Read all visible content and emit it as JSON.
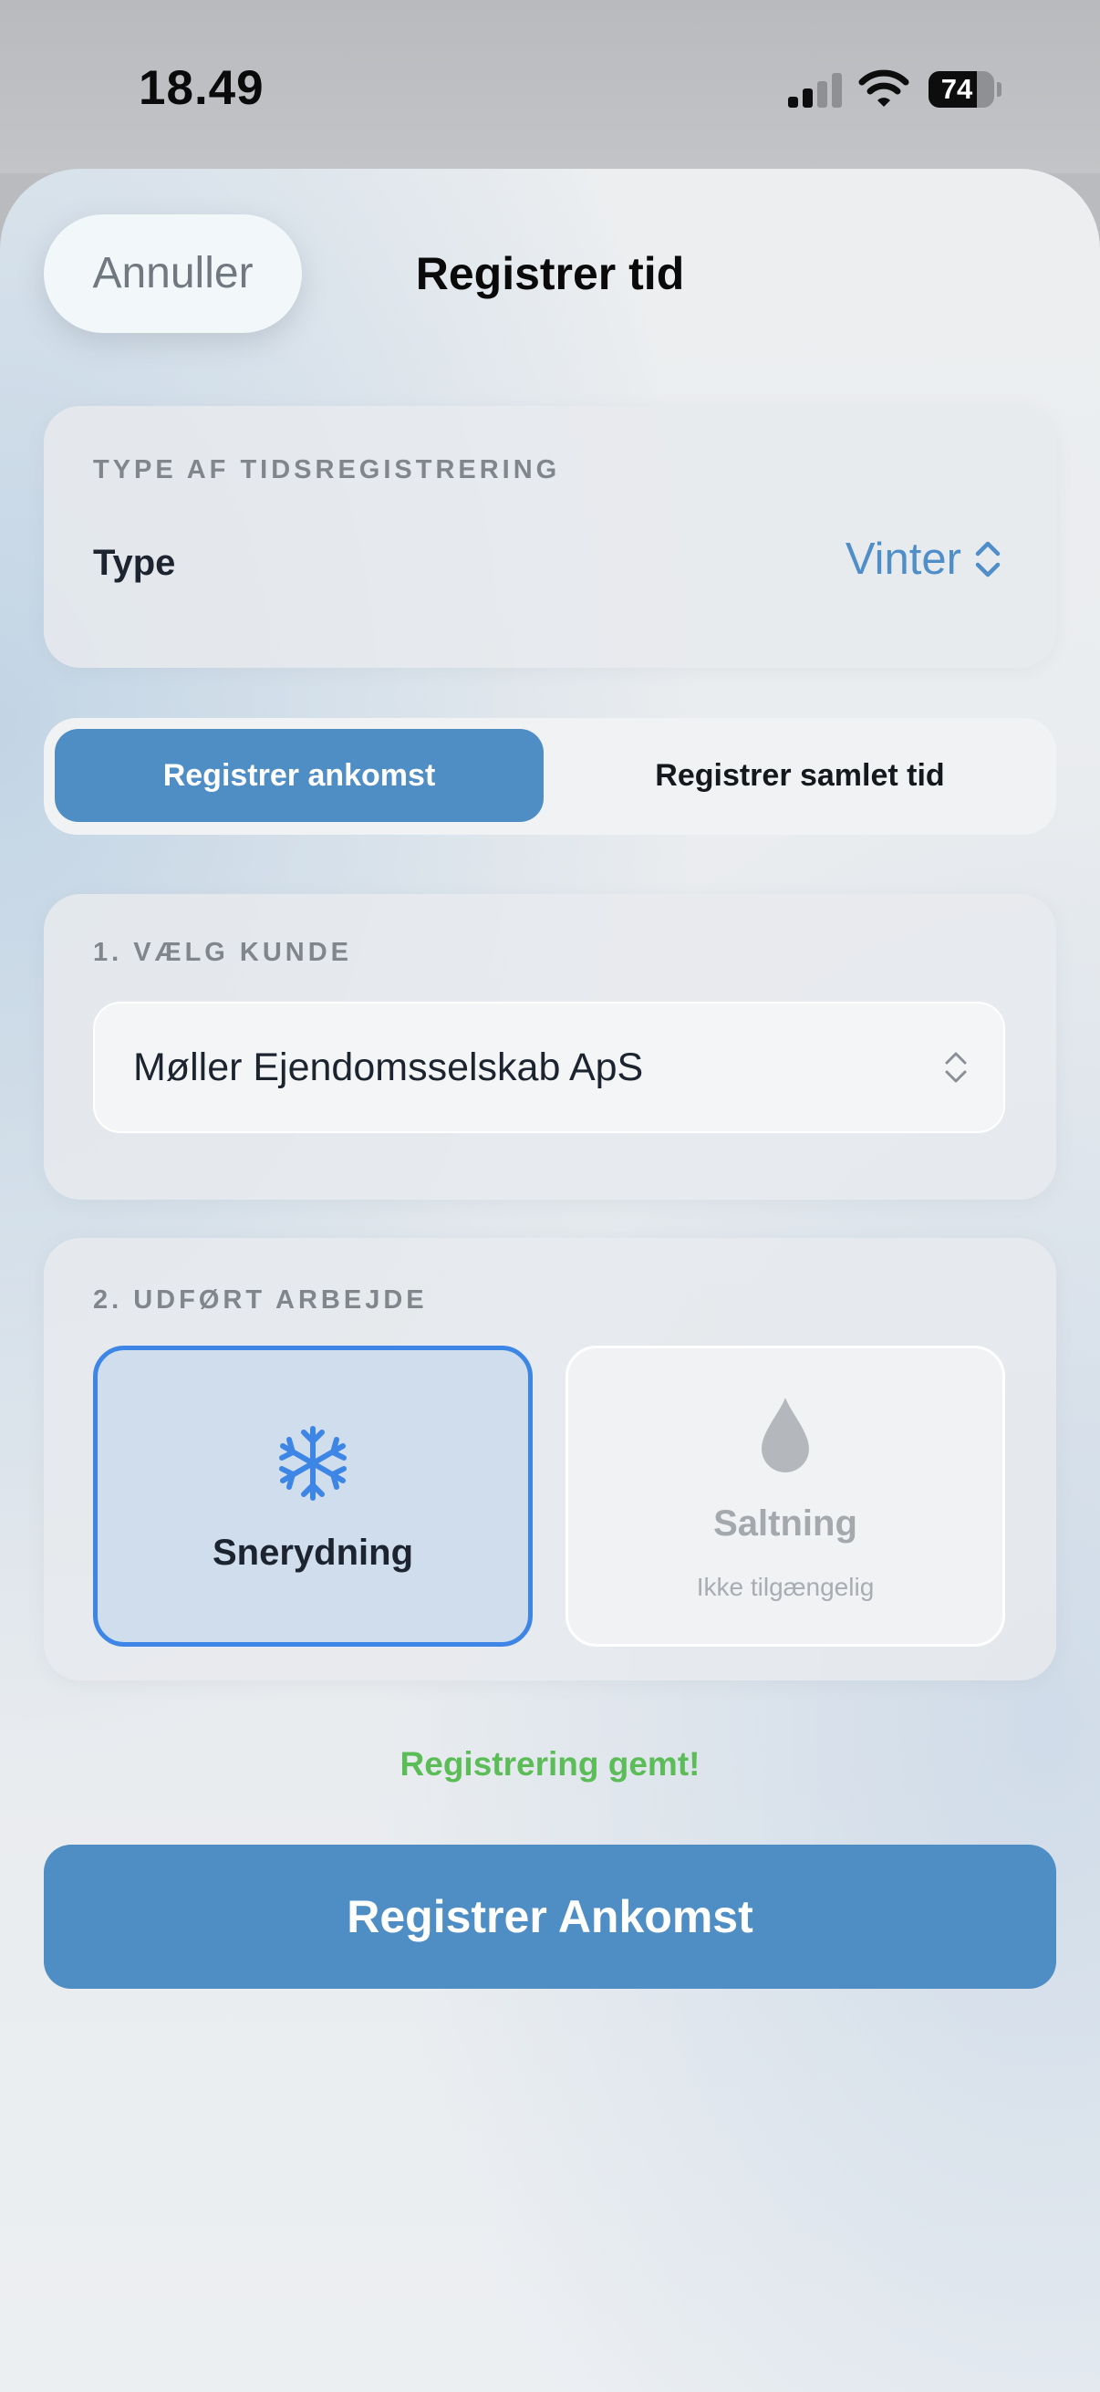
{
  "status_bar": {
    "time": "18.49",
    "battery_level": "74",
    "battery_fraction": 0.74
  },
  "header": {
    "cancel_label": "Annuller",
    "title": "Registrer tid"
  },
  "type_section": {
    "heading": "TYPE AF TIDSREGISTRERING",
    "field_label": "Type",
    "selected_value": "Vinter"
  },
  "mode_toggle": {
    "options": [
      "Registrer ankomst",
      "Registrer samlet tid"
    ],
    "selected_index": 0
  },
  "customer_section": {
    "heading": "1. VÆLG KUNDE",
    "selected_customer": "Møller Ejendomsselskab ApS"
  },
  "work_section": {
    "heading": "2. UDFØRT ARBEJDE",
    "options": [
      {
        "title": "Snerydning",
        "icon": "snowflake-icon",
        "selected": true,
        "subtitle": ""
      },
      {
        "title": "Saltning",
        "icon": "drop-icon",
        "selected": false,
        "subtitle": "Ikke tilgængelig"
      }
    ]
  },
  "status_message": "Registrering gemt!",
  "primary_action": "Registrer Ankomst",
  "colors": {
    "accent": "#4f8ec5",
    "selected_border": "#3e86e6",
    "success": "#5cbd58"
  }
}
